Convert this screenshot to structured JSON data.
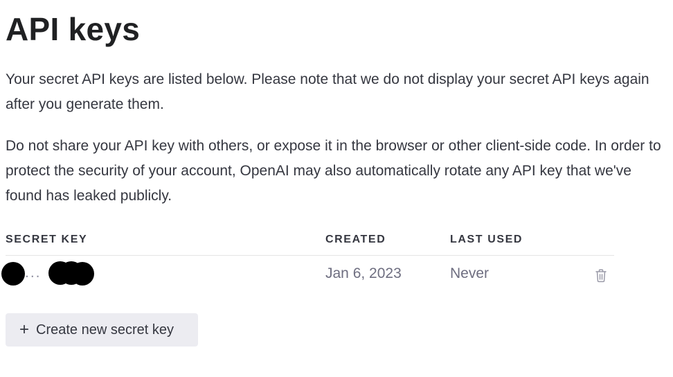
{
  "page": {
    "title": "API keys",
    "description_lines": [
      "Your secret API keys are listed below. Please note that we do not display your secret API keys again",
      "after you generate them."
    ],
    "warning_lines": [
      "Do not share your API key with others, or expose it in the browser or other client-side code. In order to",
      "protect the security of your account, OpenAI may also automatically rotate any API key that we've",
      "found has leaked publicly."
    ]
  },
  "table": {
    "columns": [
      "SECRET KEY",
      "CREATED",
      "LAST USED"
    ],
    "rows": [
      {
        "secret_key": "...",
        "created": "Jan 6, 2023",
        "last_used": "Never",
        "delete_icon": "trash-icon"
      }
    ]
  },
  "actions": {
    "create_label": "Create new secret key",
    "create_icon": "plus-icon"
  },
  "colors": {
    "title": "#202123",
    "text": "#353740",
    "muted": "#6e6e80",
    "button_bg": "#ececf1",
    "divider": "#e5e5e5"
  }
}
